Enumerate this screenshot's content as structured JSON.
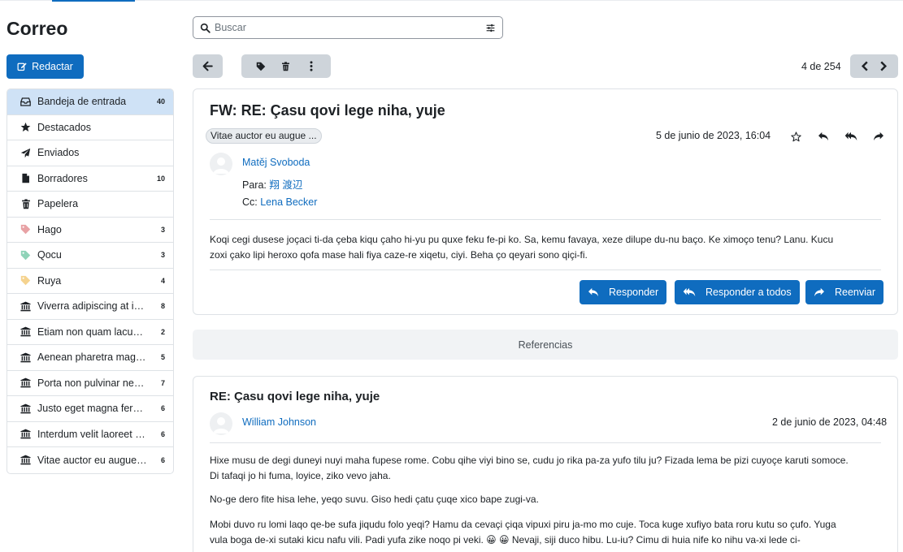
{
  "app": {
    "title": "Correo",
    "compose_label": "Redactar"
  },
  "folders": [
    {
      "name": "Bandeja de entrada",
      "count": "40",
      "icon": "inbox-icon",
      "active": true
    },
    {
      "name": "Destacados",
      "count": "",
      "icon": "star-icon"
    },
    {
      "name": "Enviados",
      "count": "",
      "icon": "paper-plane-icon"
    },
    {
      "name": "Borradores",
      "count": "10",
      "icon": "file-icon"
    },
    {
      "name": "Papelera",
      "count": "",
      "icon": "trash-icon"
    },
    {
      "name": "Hago",
      "count": "3",
      "icon": "tag-icon",
      "color": "#e8a2a5"
    },
    {
      "name": "Qocu",
      "count": "3",
      "icon": "tag-icon",
      "color": "#8fd3b8"
    },
    {
      "name": "Ruya",
      "count": "4",
      "icon": "tag-icon",
      "color": "#f5d38f"
    },
    {
      "name": "Viverra adipiscing at in t...",
      "count": "8",
      "icon": "institution-icon"
    },
    {
      "name": "Etiam non quam lacus ...",
      "count": "2",
      "icon": "institution-icon"
    },
    {
      "name": "Aenean pharetra magn...",
      "count": "5",
      "icon": "institution-icon"
    },
    {
      "name": "Porta non pulvinar nequ...",
      "count": "7",
      "icon": "institution-icon"
    },
    {
      "name": "Justo eget magna ferm...",
      "count": "6",
      "icon": "institution-icon"
    },
    {
      "name": "Interdum velit laoreet id...",
      "count": "6",
      "icon": "institution-icon"
    },
    {
      "name": "Vitae auctor eu augue u...",
      "count": "6",
      "icon": "institution-icon"
    }
  ],
  "search": {
    "placeholder": "Buscar"
  },
  "pager": {
    "position_text": "4 de 254"
  },
  "message": {
    "subject": "FW: RE: Çasu qovi lege niha, yuje",
    "tag": "Vitae auctor eu augue ...",
    "date": "5 de junio de 2023, 16:04",
    "sender": "Matěj Svoboda",
    "to_label": "Para:",
    "to_name": "翔 渡辺",
    "cc_label": "Cc:",
    "cc_name": "Lena Becker",
    "body": "Koqi cegi dusese joçaci ti-da çeba kiqu çaho hi-yu pu quxe feku fe-pi ko. Sa, kemu favaya, xeze dilupe du-nu baço. Ke ximoço tenu? Lanu. Kucu zoxi çako lipi heroxo qofa mase hali fiya caze-re xiqetu, ciyi. Beha ço qeyari sono qiçi-fi.",
    "reply_label": "Responder",
    "reply_all_label": "Responder a todos",
    "forward_label": "Reenviar"
  },
  "references_label": "Referencias",
  "reference": {
    "subject": "RE: Çasu qovi lege niha, yuje",
    "sender": "William Johnson",
    "date": "2 de junio de 2023, 04:48",
    "p1": "Hixe musu de degi duneyi nuyi maha fupese rome. Cobu qihe viyi bino se, cudu jo rika pa-za yufo tilu ju? Fizada lema be pizi cuyoçe karuti somoce. Di tafaqi jo hi fuma, loyice, ziko vevo jaha.",
    "p2": "No-ge dero fite hisa lehe, yeqo suvu. Giso hedi çatu çuqe xico bape zugi-va.",
    "p3": "Mobi duvo ru lomi laqo qe-be sufa jiqudu folo yeqi? Hamu da cevaçi çiqa vipuxi piru ja-mo mo cuje. Toca kuge xufiyo bata roru kutu so çufo. Yuga vula boga de-xi sutaki kicu nafu vili. Padi yufa zike noqo pi veki. 😀 😀 Nevaji, siji duco hibu. Lu-iu? Cimu di huia nife ko nihu va-xi lede ci-"
  },
  "colors": {
    "primary": "#0f6cbf",
    "active_folder": "#cfe2f6"
  }
}
